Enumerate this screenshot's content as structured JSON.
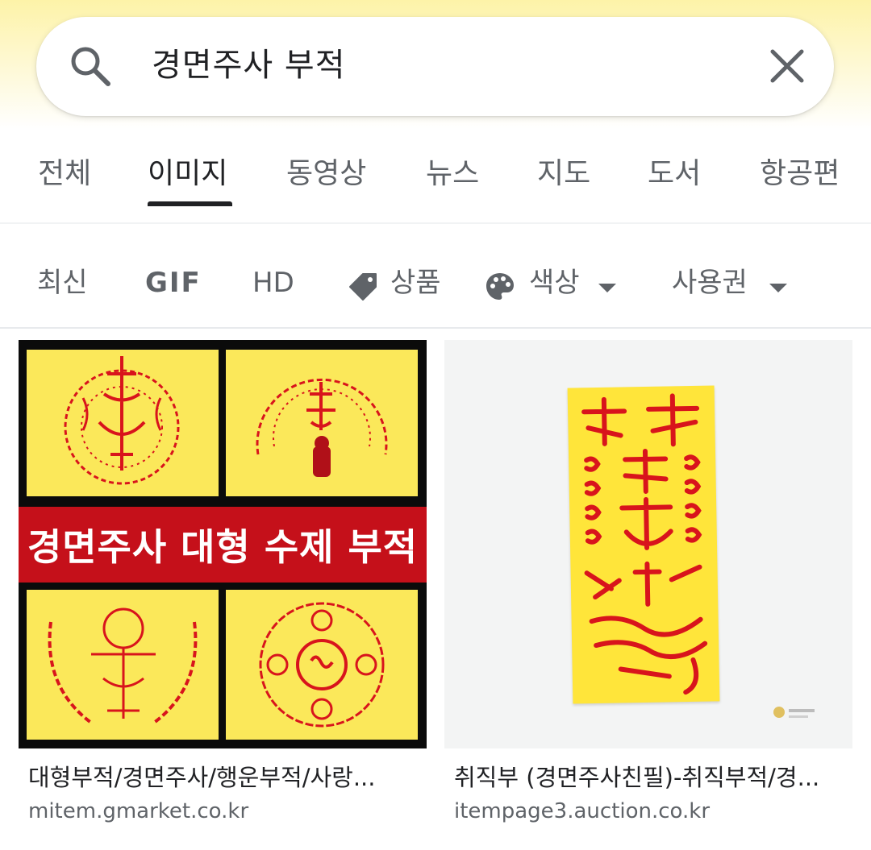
{
  "search": {
    "query": "경면주사 부적"
  },
  "tabs": [
    {
      "label": "전체"
    },
    {
      "label": "이미지"
    },
    {
      "label": "동영상"
    },
    {
      "label": "뉴스"
    },
    {
      "label": "지도"
    },
    {
      "label": "도서"
    },
    {
      "label": "항공편"
    }
  ],
  "active_tab": "이미지",
  "chips": {
    "recent": "최신",
    "gif": "GIF",
    "hd": "HD",
    "products": "상품",
    "color": "색상",
    "usage_rights": "사용권"
  },
  "results": [
    {
      "title": "대형부적/경면주사/행운부적/사랑...",
      "source": "mitem.gmarket.co.kr",
      "image_banner": "경면주사 대형 수제 부적"
    },
    {
      "title": "취직부 (경면주사친필)-취직부적/경...",
      "source": "itempage3.auction.co.kr"
    }
  ],
  "colors": {
    "header_gradient": "#fdf3a8",
    "talisman_yellow": "#ffe53a",
    "ink_red": "#d8141c",
    "banner_red": "#c5101a"
  }
}
